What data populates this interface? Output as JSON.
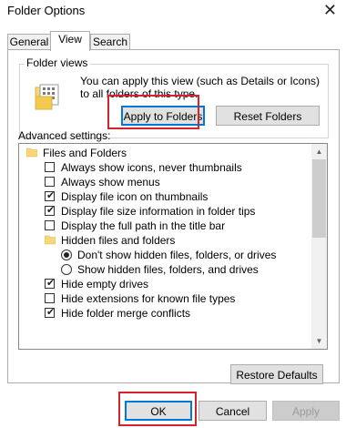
{
  "window": {
    "title": "Folder Options",
    "close_glyph": "✕"
  },
  "tabs": [
    {
      "label": "General"
    },
    {
      "label": "View"
    },
    {
      "label": "Search"
    }
  ],
  "folder_views": {
    "group_label": "Folder views",
    "description": "You can apply this view (such as Details or Icons) to all folders of this type.",
    "apply_label": "Apply to Folders",
    "reset_label": "Reset Folders"
  },
  "advanced": {
    "label": "Advanced settings:",
    "items": [
      {
        "type": "folder",
        "label": "Files and Folders"
      },
      {
        "type": "checkbox",
        "label": "Always show icons, never thumbnails",
        "checked": false
      },
      {
        "type": "checkbox",
        "label": "Always show menus",
        "checked": false
      },
      {
        "type": "checkbox",
        "label": "Display file icon on thumbnails",
        "checked": true
      },
      {
        "type": "checkbox",
        "label": "Display file size information in folder tips",
        "checked": true
      },
      {
        "type": "checkbox",
        "label": "Display the full path in the title bar",
        "checked": false
      },
      {
        "type": "folder",
        "label": "Hidden files and folders"
      },
      {
        "type": "radio",
        "label": "Don't show hidden files, folders, or drives",
        "checked": true
      },
      {
        "type": "radio",
        "label": "Show hidden files, folders, and drives",
        "checked": false
      },
      {
        "type": "checkbox",
        "label": "Hide empty drives",
        "checked": true
      },
      {
        "type": "checkbox",
        "label": "Hide extensions for known file types",
        "checked": false
      },
      {
        "type": "checkbox",
        "label": "Hide folder merge conflicts",
        "checked": true
      }
    ],
    "restore_label": "Restore Defaults"
  },
  "footer": {
    "ok_label": "OK",
    "cancel_label": "Cancel",
    "apply_label": "Apply"
  },
  "colors": {
    "accent": "#0078d7",
    "highlight": "#d6222b",
    "folder": "#f8d775"
  }
}
